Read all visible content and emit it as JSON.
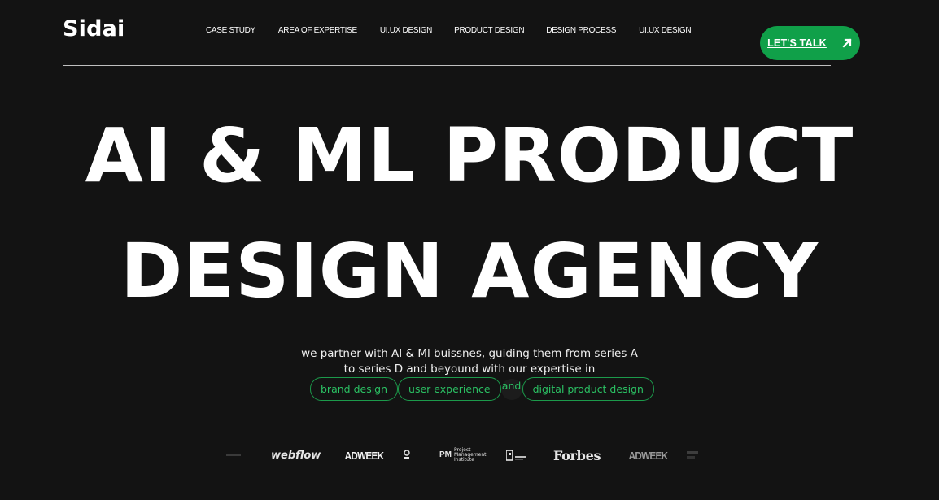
{
  "brand": {
    "logo_text": "Sidai"
  },
  "nav": {
    "items": [
      {
        "label": "CASE STUDY"
      },
      {
        "label": "AREA OF EXPERTISE"
      },
      {
        "label": "UI.UX DESIGN"
      },
      {
        "label": "PRODUCT DESIGN"
      },
      {
        "label": "DESIGN PROCESS"
      },
      {
        "label": "UI.UX DESIGN"
      }
    ],
    "cta_label": "LET'S TALK",
    "cta_icon": "arrow-up-right-icon",
    "cta_color": "#10a049"
  },
  "hero": {
    "title_line1": "AI & ML PRODUCT",
    "title_line2": "DESIGN AGENCY",
    "subtitle_line1": "we partner with AI & Ml buissnes, guiding them from series A",
    "subtitle_line2": "to series D and beyound with our expertise in",
    "tags": [
      "brand design",
      "user experience",
      "digital product design"
    ],
    "connector": "and",
    "accent_color": "#2bc063",
    "background_color": "#131313"
  },
  "logos": {
    "webflow": "webflow",
    "adweek_1": "ADWEEK",
    "pmi_mark": "PM",
    "pmi_text_1": "Project",
    "pmi_text_2": "Management",
    "pmi_text_3": "Institute",
    "forbes": "Forbes",
    "adweek_2": "ADWEEK"
  }
}
